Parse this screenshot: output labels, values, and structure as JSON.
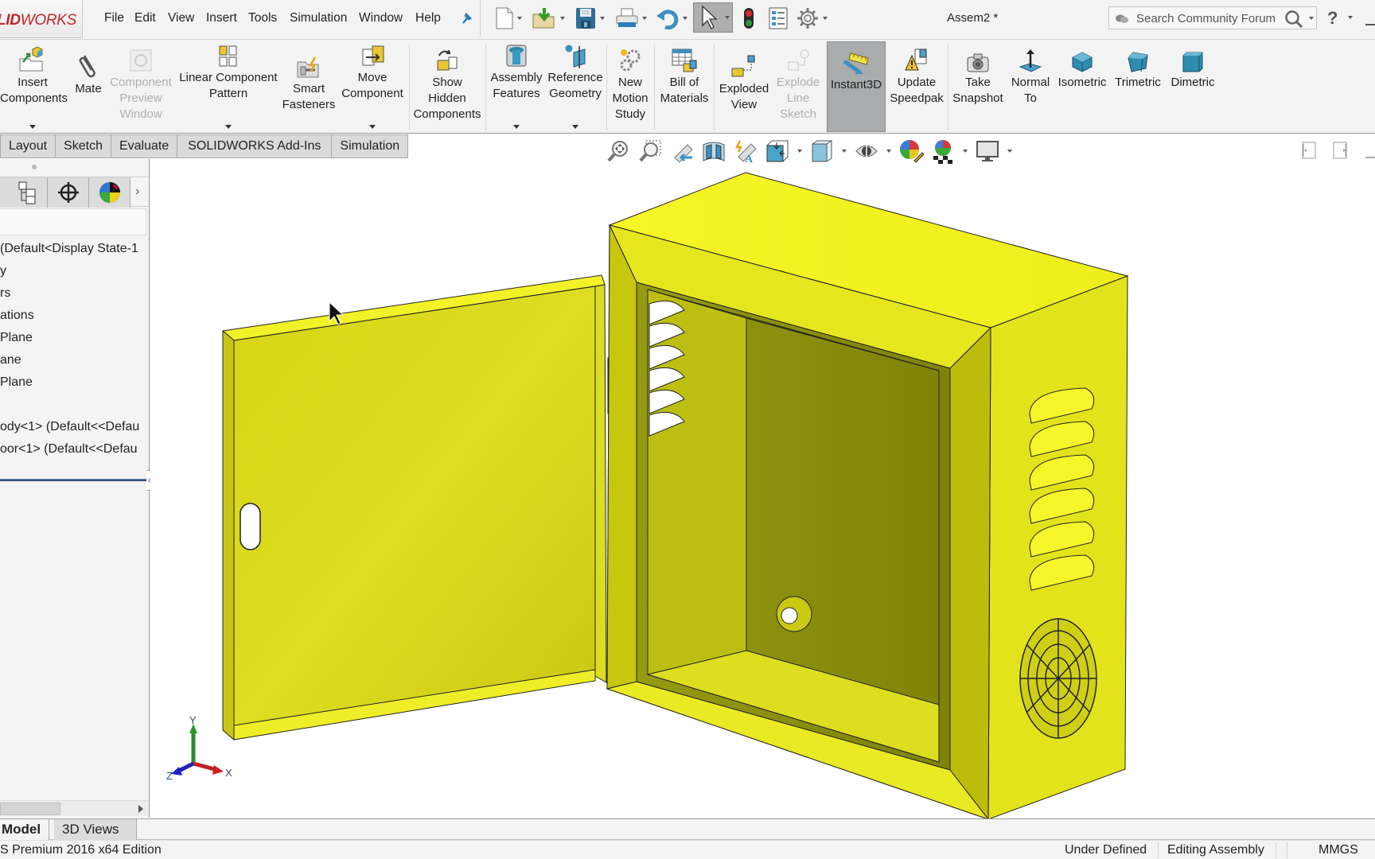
{
  "app": {
    "brand": "SOLIDWORKS",
    "brand_visible_prefix": "LID",
    "brand_visible_suffix": "WORKS",
    "document_title": "Assem2 *",
    "brand_color": "#c4262e",
    "model_color": "#f0f020"
  },
  "menu": {
    "items": [
      "File",
      "Edit",
      "View",
      "Insert",
      "Tools",
      "Simulation",
      "Window",
      "Help"
    ],
    "pin_icon": "pin-icon"
  },
  "quick_access": {
    "icons": [
      "new-document-icon",
      "open-icon",
      "save-icon",
      "print-icon",
      "undo-icon",
      "select-icon",
      "rebuild-traffic-light-icon",
      "file-properties-icon",
      "options-gear-icon"
    ]
  },
  "search": {
    "placeholder": "Search Community Forum",
    "help_label": "?"
  },
  "ribbon": {
    "buttons": [
      {
        "label": "Insert\nComponents",
        "icon": "insert-components-icon",
        "enabled": true,
        "dropdown": true
      },
      {
        "label": "Mate",
        "icon": "paperclip-mate-icon",
        "enabled": true,
        "dropdown": false
      },
      {
        "label": "Component\nPreview\nWindow",
        "icon": "component-preview-icon",
        "enabled": false,
        "dropdown": false
      },
      {
        "label": "Linear Component\nPattern",
        "icon": "linear-pattern-icon",
        "enabled": true,
        "dropdown": true
      },
      {
        "label": "Smart\nFasteners",
        "icon": "smart-fasteners-icon",
        "enabled": true,
        "dropdown": false
      },
      {
        "label": "Move\nComponent",
        "icon": "move-component-icon",
        "enabled": true,
        "dropdown": true
      },
      {
        "label": "Show\nHidden\nComponents",
        "icon": "show-hidden-icon",
        "enabled": true,
        "dropdown": false
      },
      {
        "label": "Assembly\nFeatures",
        "icon": "assembly-features-icon",
        "enabled": true,
        "dropdown": true
      },
      {
        "label": "Reference\nGeometry",
        "icon": "reference-geometry-icon",
        "enabled": true,
        "dropdown": true
      },
      {
        "label": "New\nMotion\nStudy",
        "icon": "motion-study-gears-icon",
        "enabled": true,
        "dropdown": false
      },
      {
        "label": "Bill of\nMaterials",
        "icon": "bill-of-materials-icon",
        "enabled": true,
        "dropdown": false
      },
      {
        "label": "Exploded\nView",
        "icon": "exploded-view-icon",
        "enabled": true,
        "dropdown": false
      },
      {
        "label": "Explode\nLine\nSketch",
        "icon": "explode-line-sketch-icon",
        "enabled": false,
        "dropdown": false
      },
      {
        "label": "Instant3D",
        "icon": "instant3d-ruler-icon",
        "enabled": true,
        "active": true,
        "dropdown": false
      },
      {
        "label": "Update\nSpeedpak",
        "icon": "update-speedpak-icon",
        "enabled": true,
        "dropdown": false
      },
      {
        "label": "Take\nSnapshot",
        "icon": "camera-icon",
        "enabled": true,
        "dropdown": false
      },
      {
        "label": "Normal\nTo",
        "icon": "normal-to-icon",
        "enabled": true,
        "dropdown": false
      },
      {
        "label": "Isometric",
        "icon": "isometric-cube-icon",
        "enabled": true,
        "dropdown": false
      },
      {
        "label": "Trimetric",
        "icon": "trimetric-cube-icon",
        "enabled": true,
        "dropdown": false
      },
      {
        "label": "Dimetric",
        "icon": "dimetric-cube-icon",
        "enabled": true,
        "dropdown": false
      }
    ]
  },
  "command_tabs": [
    "Layout",
    "Sketch",
    "Evaluate",
    "SOLIDWORKS Add-Ins",
    "Simulation"
  ],
  "heads_up_toolbar": {
    "icons": [
      "zoom-to-fit-icon",
      "zoom-to-area-icon",
      "previous-view-icon",
      "section-view-icon",
      "dynamic-annotation-views-icon",
      "view-orientation-icon",
      "display-style-icon",
      "hide-show-items-icon",
      "edit-appearance-icon",
      "apply-scene-icon",
      "view-settings-monitor-icon"
    ]
  },
  "left_panel": {
    "tab_icons": [
      "feature-manager-icon",
      "property-manager-icon",
      "configuration-manager-icon",
      "dim-xpert-crosshair-icon",
      "display-manager-icon"
    ],
    "more_label": "›",
    "tree_items": [
      "(Default<Display State-1",
      "y",
      "rs",
      "ations",
      "Plane",
      "ane",
      "Plane",
      "",
      "ody<1> (Default<<Defau",
      "oor<1> (Default<<Defau"
    ]
  },
  "bottom_tabs": [
    "Model",
    "3D Views"
  ],
  "active_bottom_tab": "Model",
  "status_bar": {
    "edition": "S Premium 2016 x64 Edition",
    "definition": "Under Defined",
    "mode": "Editing Assembly",
    "units": "MMGS"
  },
  "triad": {
    "x": "X",
    "y": "Y",
    "z": "Z"
  }
}
